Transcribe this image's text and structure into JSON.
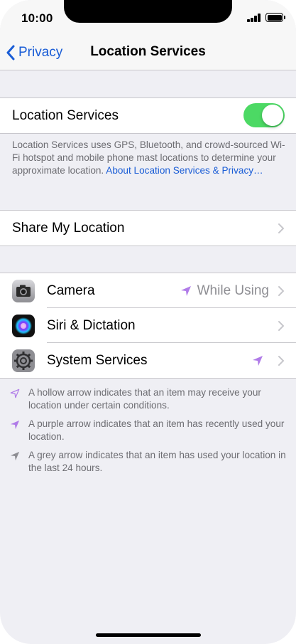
{
  "status_bar": {
    "time": "10:00"
  },
  "nav": {
    "back_label": "Privacy",
    "title": "Location Services"
  },
  "location_services": {
    "label": "Location Services",
    "enabled": true,
    "description": "Location Services uses GPS, Bluetooth, and crowd-sourced Wi-Fi hotspot and mobile phone mast locations to determine your approximate location.",
    "link_text": "About Location Services & Privacy…"
  },
  "share_my_location": {
    "label": "Share My Location"
  },
  "apps": [
    {
      "name": "Camera",
      "icon": "camera-icon",
      "detail": "While Using",
      "arrow": "purple"
    },
    {
      "name": "Siri & Dictation",
      "icon": "siri-icon",
      "detail": "",
      "arrow": ""
    },
    {
      "name": "System Services",
      "icon": "gear-icon",
      "detail": "",
      "arrow": "purple"
    }
  ],
  "legend": [
    {
      "arrow": "hollow",
      "text": "A hollow arrow indicates that an item may receive your location under certain conditions."
    },
    {
      "arrow": "purple",
      "text": "A purple arrow indicates that an item has recently used your location."
    },
    {
      "arrow": "grey",
      "text": "A grey arrow indicates that an item has used your location in the last 24 hours."
    }
  ],
  "colors": {
    "accent": "#1a5dd6",
    "toggle_on": "#4cd964",
    "purple_arrow": "#b07be8",
    "grey_arrow": "#8e8e93"
  }
}
